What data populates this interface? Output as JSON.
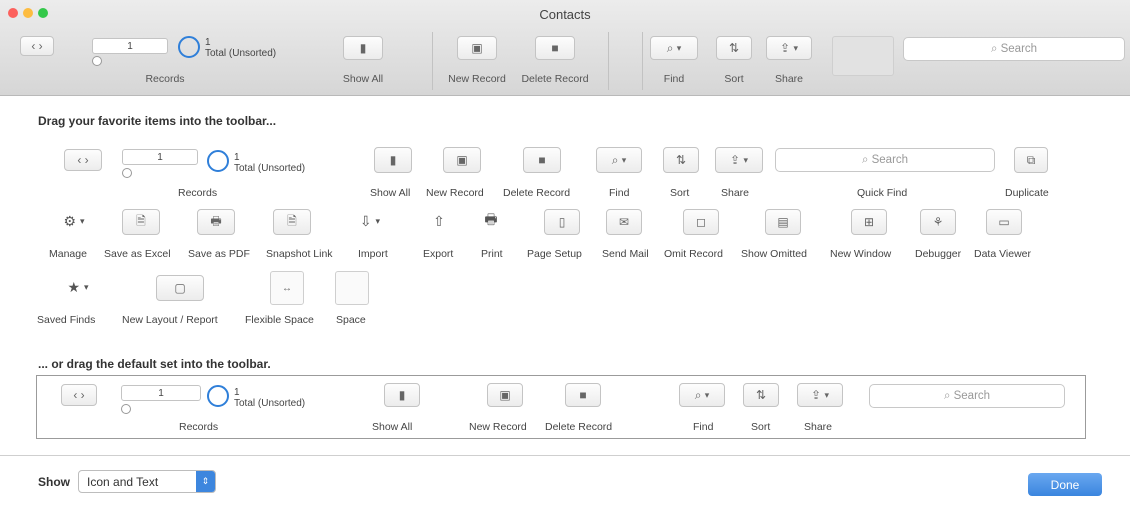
{
  "window": {
    "title": "Contacts",
    "traffic_lights": [
      "close-red",
      "minimize-yellow",
      "zoom-green"
    ],
    "colors": {
      "close": "#fc615d",
      "minimize": "#fdbc40",
      "zoom": "#34c84a",
      "accent": "#3a85de"
    }
  },
  "toolbar": {
    "records": {
      "current": "1",
      "total_count": "1",
      "total_label": "Total (Unsorted)",
      "label": "Records"
    },
    "show_all": "Show All",
    "new_record": "New Record",
    "delete_record": "Delete Record",
    "find": "Find",
    "sort": "Sort",
    "share": "Share",
    "search_placeholder": "Search"
  },
  "customize": {
    "heading1": "Drag your favorite items into the toolbar...",
    "records": {
      "current": "1",
      "total_count": "1",
      "total_label": "Total (Unsorted)",
      "label": "Records"
    },
    "row1": {
      "show_all": "Show All",
      "new_record": "New Record",
      "delete_record": "Delete Record",
      "find": "Find",
      "sort": "Sort",
      "share": "Share",
      "quick_find": "Quick Find",
      "quick_find_placeholder": "Search",
      "duplicate": "Duplicate"
    },
    "row2": {
      "manage": "Manage",
      "save_excel": "Save as Excel",
      "save_pdf": "Save as PDF",
      "snapshot": "Snapshot Link",
      "import": "Import",
      "export": "Export",
      "print": "Print",
      "page_setup": "Page Setup",
      "send_mail": "Send Mail",
      "omit_record": "Omit Record",
      "show_omitted": "Show Omitted",
      "new_window": "New Window",
      "debugger": "Debugger",
      "data_viewer": "Data Viewer"
    },
    "row3": {
      "saved_finds": "Saved Finds",
      "new_layout": "New Layout / Report",
      "flexible_space": "Flexible Space",
      "space": "Space"
    },
    "heading2": "... or drag the default set into the toolbar.",
    "default_set": {
      "records": {
        "current": "1",
        "total_count": "1",
        "total_label": "Total (Unsorted)",
        "label": "Records"
      },
      "show_all": "Show All",
      "new_record": "New Record",
      "delete_record": "Delete Record",
      "find": "Find",
      "sort": "Sort",
      "share": "Share",
      "search_placeholder": "Search"
    }
  },
  "footer": {
    "show_label": "Show",
    "show_value": "Icon and Text",
    "done": "Done"
  },
  "icons": {
    "nav": "‹ ›",
    "show_all": "▮",
    "new_record": "▣",
    "delete_record": "■",
    "find": "⌕",
    "sort": "⇅",
    "share": "⇪",
    "manage": "⚙",
    "save_excel": "🗎",
    "save_pdf": "🖶",
    "snapshot": "🗎",
    "import": "⇩",
    "export": "⇧",
    "print": "🖶",
    "page_setup": "▯",
    "send_mail": "✉",
    "omit_record": "◻",
    "show_omitted": "▤",
    "new_window": "⊞",
    "debugger": "⚘",
    "data_viewer": "▭",
    "saved_finds": "★",
    "new_layout": "▢",
    "duplicate": "⧉",
    "dropdown": "▾",
    "search": "⌕"
  }
}
